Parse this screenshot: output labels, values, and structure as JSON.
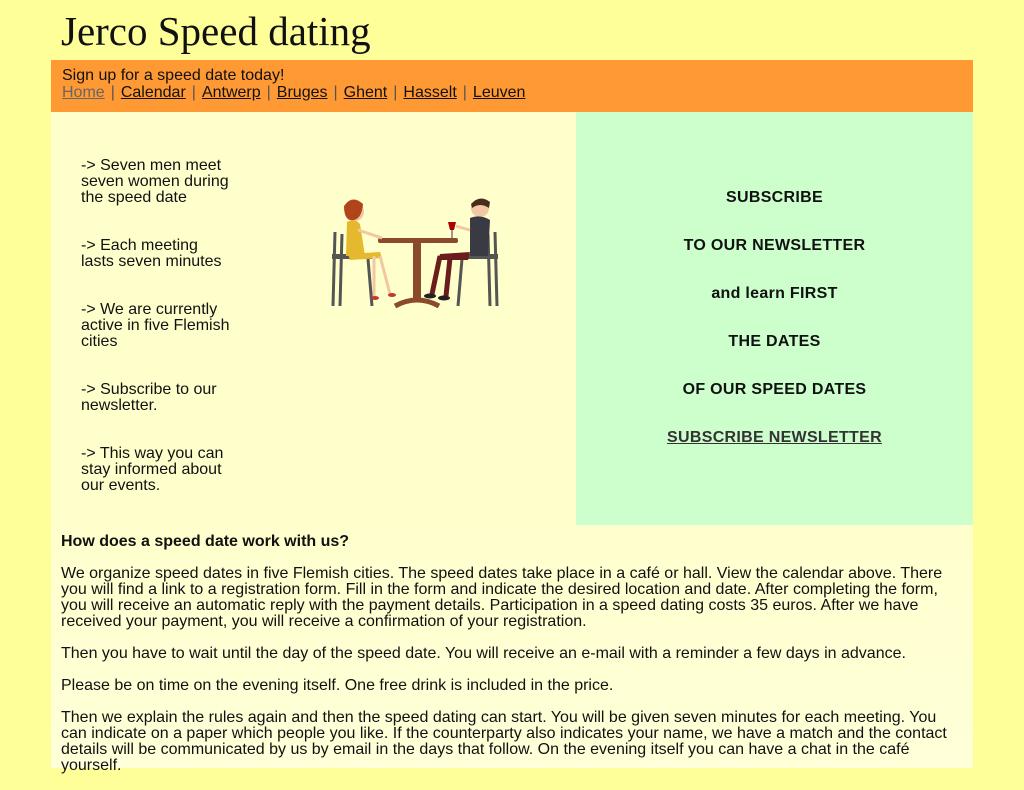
{
  "site": {
    "title": "Jerco Speed dating"
  },
  "nav": {
    "tagline": "Sign up for a speed date today!",
    "links": [
      "Home",
      "Calendar",
      "Antwerp",
      "Bruges",
      "Ghent",
      "Hasselt",
      "Leuven"
    ],
    "separator": "|"
  },
  "features": [
    "-> Seven men meet seven women during the speed date",
    "-> Each meeting lasts seven minutes",
    "-> We are currently active in five Flemish cities",
    "-> Subscribe to our newsletter.",
    "-> This way you can stay informed about our events."
  ],
  "illustration": {
    "icon": "couple-at-table-illustration"
  },
  "newsletter": {
    "lines": [
      "SUBSCRIBE",
      "TO OUR NEWSLETTER",
      "and learn FIRST",
      "THE DATES",
      "OF OUR SPEED DATES"
    ],
    "link_label": "SUBSCRIBE NEWSLETTER"
  },
  "article": {
    "heading": "How does a speed date work with us?",
    "paragraphs": [
      "We organize speed dates in five Flemish cities. The speed dates take place in a café or hall. View the calendar above. There you will find a link to a registration form. Fill in the form and indicate the desired location and date. After completing the form, you will receive an automatic reply with the payment details. Participation in a speed dating costs 35 euros. After we have received your payment, you will receive a confirmation of your registration.",
      "Then you have to wait until the day of the speed date. You will receive an e-mail with a reminder a few days in advance.",
      "Please be on time on the evening itself. One free drink is included in the price.",
      "Then we explain the rules again and then the speed dating can start. You will be given seven minutes for each meeting. You can indicate on a paper which people you like. If the counterparty also indicates your name, we have a match and the contact details will be communicated by us by email in the days that follow. On the evening itself you can have a chat in the café yourself."
    ]
  },
  "colors": {
    "page_background": "#ffff99",
    "nav_background": "#ff9933",
    "content_background": "#ffffcc",
    "newsletter_background": "#ccffcc"
  }
}
